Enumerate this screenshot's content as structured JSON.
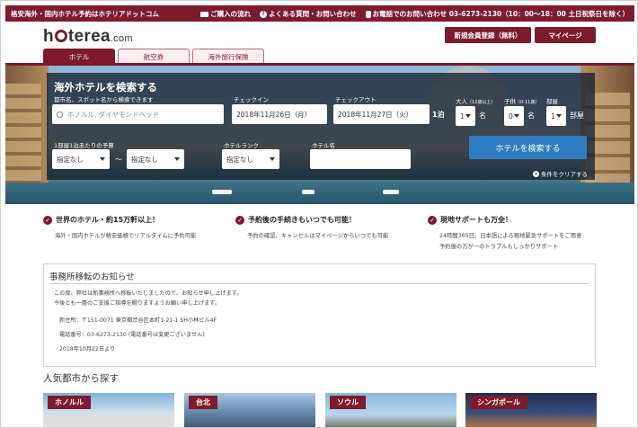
{
  "topbar": {
    "tagline": "格安海外・国内ホテル予約はホテリアドットコム",
    "links": [
      "ご購入の流れ",
      "よくある質問・お問い合わせ"
    ],
    "phone_label": "お電話でのお問い合わせ",
    "phone_number": "03-6273-2130",
    "hours": "（10：00～18：00 土日祝祭日を除く）"
  },
  "header": {
    "logo_text": "hoterea",
    "logo_suffix": ".com",
    "register_label": "新規会員登録（無料）",
    "mypage_label": "マイページ"
  },
  "tabs": [
    {
      "label": "ホテル",
      "active": true
    },
    {
      "label": "航空券",
      "active": false
    },
    {
      "label": "海外旅行保険",
      "active": false
    }
  ],
  "search": {
    "title": "海外ホテルを検索する",
    "destination_label": "都市名、スポット名から検索できます",
    "destination_placeholder": "ホノルル, ダイヤモンドヘッド",
    "checkin_label": "チェックイン",
    "checkin_value": "2018年11月26日（月）",
    "checkout_label": "チェックアウト",
    "checkout_value": "2018年11月27日（火）",
    "nights": "1泊",
    "adults_label": "大人",
    "adults_note": "（12歳以上）",
    "adults_value": "1",
    "children_label": "子供",
    "children_note": "（0-11歳）",
    "children_value": "0",
    "rooms_label": "部屋",
    "rooms_value": "1",
    "person_unit": "名",
    "room_unit": "部屋",
    "budget_label": "1部屋1泊あたりの予算",
    "budget_min": "指定なし",
    "budget_sep": "〜",
    "budget_max": "指定なし",
    "rank_label": "ホテルランク",
    "rank_value": "指定なし",
    "hotel_name_label": "ホテル名",
    "hotel_name_value": "",
    "submit_label": "ホテルを検索する",
    "clear_label": "条件をクリアする"
  },
  "features": [
    {
      "heading": "世界のホテル・約15万軒以上！",
      "lines": [
        "海外・国内ホテルが格安価格でリアルタイムに予約可能"
      ]
    },
    {
      "heading": "予約後の手続きもいつでも可能！",
      "lines": [
        "予約の確認、キャンセルはマイページからいつでも可能"
      ]
    },
    {
      "heading": "現地サポートも万全！",
      "lines": [
        "24時間365日、日本語による現地緊急サポートをご用意",
        "予約後の万が一のトラブルもしっかりサポート"
      ]
    }
  ],
  "notice": {
    "title": "事務所移転のお知らせ",
    "line1": "この度、弊社は新事務所へ移転いたしましたので、お知らせ申し上げます。",
    "line2": "今後とも一層のご支援ご指導を賜りますようお願い申し上げます。",
    "address": "新住所：〒151-0071 東京都渋谷区本町1-21-1 SH小林ビル4F",
    "phone": "電話番号：03-6273-2130 (電話番号は変更ございません)",
    "date": "2018年10月22日より"
  },
  "cities": {
    "title": "人気都市から探す",
    "items": [
      "ホノルル",
      "台北",
      "ソウル",
      "シンガポール"
    ]
  },
  "colors": {
    "brand": "#7d1a2c",
    "search_button": "#2d7ec0"
  }
}
